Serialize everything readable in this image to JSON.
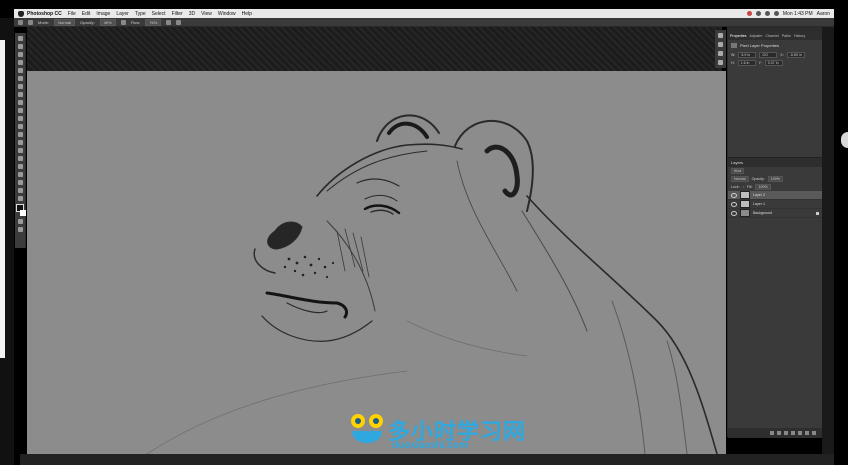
{
  "menubar": {
    "app_name": "Photoshop CC",
    "items": [
      "File",
      "Edit",
      "Image",
      "Layer",
      "Type",
      "Select",
      "Filter",
      "3D",
      "View",
      "Window",
      "Help"
    ],
    "clock": "Mon 1:43 PM",
    "user": "Aaron"
  },
  "options_bar": {
    "mode_label": "Mode:",
    "mode_value": "Normal",
    "opacity_label": "Opacity:",
    "opacity_value": "40%",
    "flow_label": "Flow:",
    "flow_value": "76%"
  },
  "properties_panel": {
    "tabs": [
      "Properties",
      "Adjustm",
      "Channel",
      "Paths",
      "History"
    ],
    "heading": "Pixel Layer Properties",
    "w_label": "W:",
    "w_value": "6.9 in",
    "go_label": "GO",
    "x_label": "X:",
    "x_value": "-5.69 in",
    "h_label": "H:",
    "h_value": "1.6 in",
    "y_label": "Y:",
    "y_value": "0.07 in"
  },
  "layers_panel": {
    "title": "Layers",
    "filter_kind": "Kind",
    "blend_mode": "Normal",
    "opacity_label": "Opacity:",
    "opacity_value": "100%",
    "lock_label": "Lock:",
    "fill_label": "Fill:",
    "fill_value": "100%",
    "layers": [
      {
        "name": "Layer 2",
        "selected": true
      },
      {
        "name": "Layer 1",
        "selected": false
      },
      {
        "name": "Background",
        "selected": false,
        "locked": true
      }
    ]
  },
  "watermark": {
    "cn_text": "多小时学习网",
    "url": "duoxiaoshi.com"
  },
  "colors": {
    "canvas": "#8c8c8c",
    "panel": "#3a3a3a",
    "watermark": "#2fa8e0"
  }
}
